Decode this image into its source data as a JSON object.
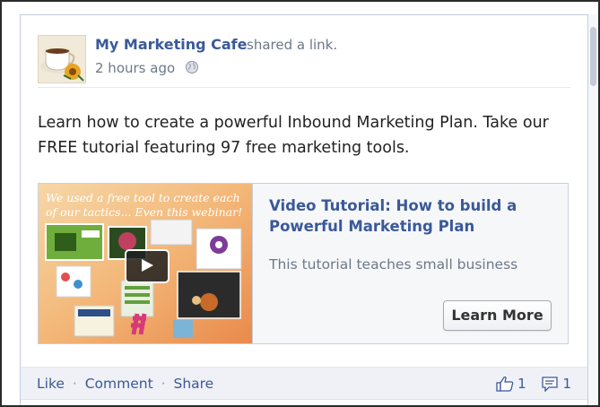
{
  "post": {
    "author": "My Marketing Cafe",
    "action": "shared a link.",
    "time": "2 hours ago",
    "privacy_icon": "globe-icon",
    "message_line1": "Learn how to create a powerful Inbound Marketing Plan. Take our",
    "message_line2": "FREE tutorial featuring 97 free marketing tools."
  },
  "attachment": {
    "thumbnail_caption": "We used a free tool to create each of our tactics... Even this webinar!",
    "title": "Video Tutorial: How to build a Powerful Marketing Plan",
    "description": "This tutorial teaches small business",
    "button_label": "Learn More"
  },
  "footer": {
    "like": "Like",
    "comment": "Comment",
    "share": "Share",
    "separator": "·",
    "like_count": "1",
    "comment_count": "1"
  },
  "colors": {
    "link_blue": "#3b5998",
    "muted_gray": "#6d7888",
    "footer_bg": "#eff1f6"
  }
}
